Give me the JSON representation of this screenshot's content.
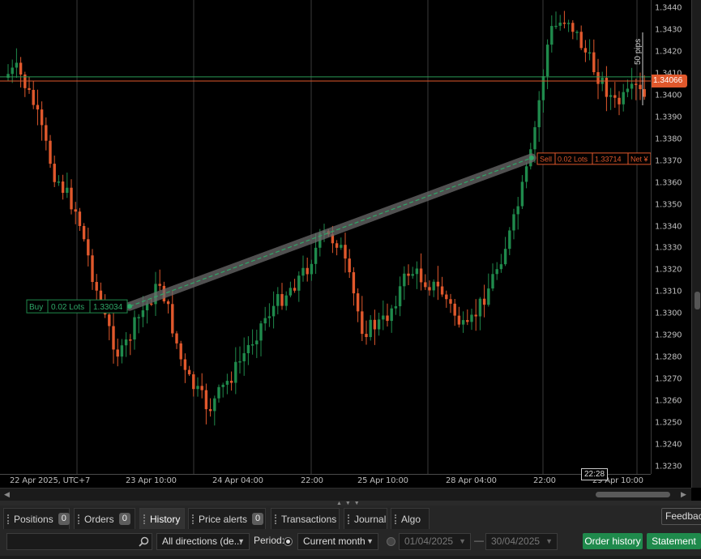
{
  "chart": {
    "price_ticks": [
      "1.3440",
      "1.3430",
      "1.3420",
      "1.3410",
      "1.3400",
      "1.3390",
      "1.3380",
      "1.3370",
      "1.3360",
      "1.3350",
      "1.3340",
      "1.3330",
      "1.3320",
      "1.3310",
      "1.3300",
      "1.3290",
      "1.3280",
      "1.3270",
      "1.3260",
      "1.3250",
      "1.3240",
      "1.3230"
    ],
    "current_price": "1.34066",
    "time_labels": [
      "22 Apr 2025, UTC+7",
      "23 Apr 10:00",
      "24 Apr 04:00",
      "22:00",
      "25 Apr 10:00",
      "28 Apr 04:00",
      "22:00",
      "29 Apr 10:00"
    ],
    "crosshair_time": "22:28",
    "pips_label": "50 pips",
    "buy_label": {
      "side": "Buy",
      "lots": "0.02 Lots",
      "price": "1.33034"
    },
    "sell_label": {
      "side": "Sell",
      "lots": "0.02 Lots",
      "price": "1.33714",
      "net": "Net ¥"
    },
    "colors": {
      "bull": "#1f8a4c",
      "bear": "#e0582c",
      "grid": "#3a3a3a",
      "price_line": "#e0582c",
      "hline": "#2a9a55"
    }
  },
  "tabs": [
    {
      "label": "Positions",
      "badge": "0"
    },
    {
      "label": "Orders",
      "badge": "0"
    },
    {
      "label": "History",
      "badge": ""
    },
    {
      "label": "Price alerts",
      "badge": "0"
    },
    {
      "label": "Transactions",
      "badge": ""
    },
    {
      "label": "Journal",
      "badge": ""
    },
    {
      "label": "Algo",
      "badge": ""
    }
  ],
  "feedback_label": "Feedback",
  "toolbar": {
    "search_placeholder": "",
    "direction": "All directions (de...",
    "period_label": "Period:",
    "period_value": "Current month",
    "date_from": "01/04/2025",
    "date_sep": "—",
    "date_to": "30/04/2025",
    "order_history": "Order history",
    "statement": "Statement"
  }
}
